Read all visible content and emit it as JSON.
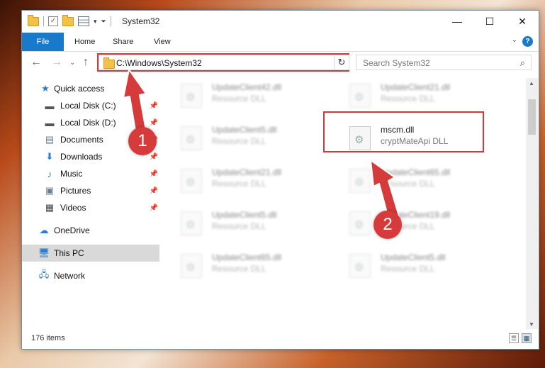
{
  "window": {
    "title": "System32"
  },
  "ribbon": {
    "tabs": [
      "File",
      "Home",
      "Share",
      "View"
    ]
  },
  "address": {
    "path": "C:\\Windows\\System32"
  },
  "search": {
    "placeholder": "Search System32"
  },
  "nav": {
    "items": [
      {
        "label": "Quick access",
        "icon": "star-icon"
      },
      {
        "label": "Local Disk (C:)",
        "icon": "drive-icon",
        "pinned": true
      },
      {
        "label": "Local Disk (D:)",
        "icon": "drive-icon",
        "pinned": true
      },
      {
        "label": "Documents",
        "icon": "documents-icon",
        "pinned": true
      },
      {
        "label": "Downloads",
        "icon": "download-icon",
        "pinned": true
      },
      {
        "label": "Music",
        "icon": "music-icon",
        "pinned": true
      },
      {
        "label": "Pictures",
        "icon": "pictures-icon",
        "pinned": true
      },
      {
        "label": "Videos",
        "icon": "videos-icon",
        "pinned": true
      },
      {
        "label": "OneDrive",
        "icon": "cloud-icon"
      },
      {
        "label": "This PC",
        "icon": "computer-icon",
        "selected": true
      },
      {
        "label": "Network",
        "icon": "network-icon"
      }
    ]
  },
  "files": [
    {
      "name": "UpdateClient42.dll",
      "type": "Resource DLL"
    },
    {
      "name": "UpdateClient21.dll",
      "type": "Resource DLL"
    },
    {
      "name": "UpdateClient5.dll",
      "type": "Resource DLL"
    },
    {
      "name": "mscm.dll",
      "type": "cryptMateApi DLL"
    },
    {
      "name": "UpdateClient21.dll",
      "type": "Resource DLL"
    },
    {
      "name": "UpdateClient65.dll",
      "type": "Resource DLL"
    },
    {
      "name": "UpdateClient5.dll",
      "type": "Resource DLL"
    },
    {
      "name": "UpdateClient19.dll",
      "type": "Resource DLL"
    },
    {
      "name": "UpdateClient65.dll",
      "type": "Resource DLL"
    },
    {
      "name": "UpdateClient5.dll",
      "type": "Resource DLL"
    }
  ],
  "status": {
    "count": "176 items"
  },
  "annotations": {
    "step1": "1",
    "step2": "2",
    "color": "#d13a3a"
  }
}
